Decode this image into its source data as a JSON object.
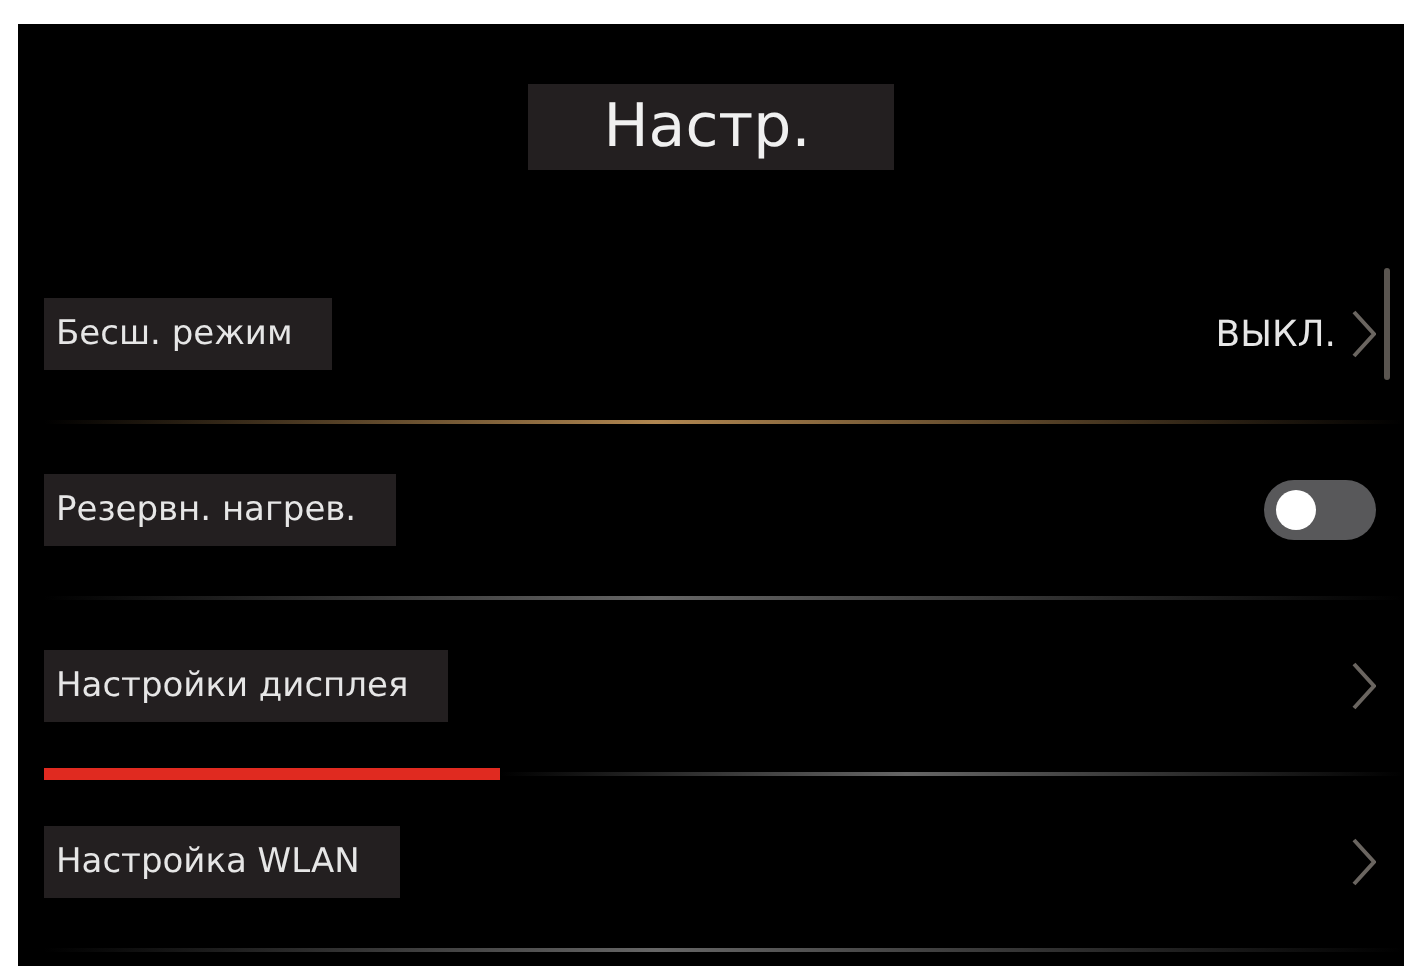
{
  "screen": {
    "title": "Настр."
  },
  "settings": [
    {
      "kind": "link",
      "label": "Бесш. режим",
      "value": "ВЫКЛ.",
      "selected": false
    },
    {
      "kind": "toggle",
      "label": "Резервн. нагрев.",
      "on": false,
      "selected": false
    },
    {
      "kind": "link",
      "label": "Настройки дисплея",
      "selected": true
    },
    {
      "kind": "link",
      "label": "Настройка WLAN",
      "selected": false
    }
  ]
}
